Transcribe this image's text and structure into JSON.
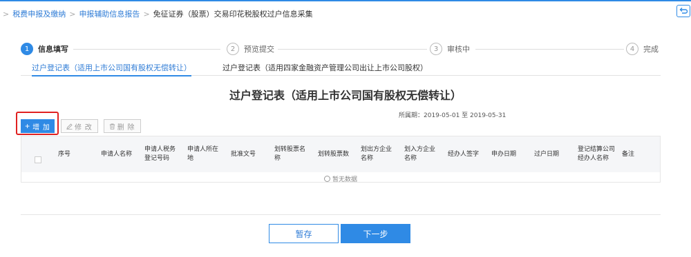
{
  "breadcrumb": {
    "items": [
      "税费申报及缴纳",
      "申报辅助信息报告"
    ],
    "current": "免征证券（股票）交易印花税股权过户信息采集"
  },
  "steps": [
    {
      "num": "1",
      "label": "信息填写",
      "active": true
    },
    {
      "num": "2",
      "label": "预览提交",
      "active": false
    },
    {
      "num": "3",
      "label": "审核中",
      "active": false
    },
    {
      "num": "4",
      "label": "完成",
      "active": false
    }
  ],
  "tabs": [
    {
      "label": "过户登记表（适用上市公司国有股权无偿转让）",
      "active": true
    },
    {
      "label": "过户登记表（适用四家金融资产管理公司出让上市公司股权）",
      "active": false
    }
  ],
  "form": {
    "title": "过户登记表（适用上市公司国有股权无偿转让）",
    "period": "所属期：2019-05-01 至 2019-05-31"
  },
  "toolbar": {
    "add_label": "增 加",
    "edit_label": "修 改",
    "delete_label": "删 除"
  },
  "table": {
    "columns": [
      "序号",
      "申请人名称",
      "申请人税务登记号码",
      "申请人所在地",
      "批准文号",
      "划转股票名称",
      "划转股票数",
      "划出方企业名称",
      "划入方企业名称",
      "经办人签字",
      "申办日期",
      "过户日期",
      "登记结算公司经办人名称",
      "备注"
    ],
    "empty_text": "暂无数据"
  },
  "actions": {
    "save_label": "暂存",
    "next_label": "下一步"
  },
  "colors": {
    "primary": "#2f8ae5",
    "highlight": "#e02020"
  }
}
